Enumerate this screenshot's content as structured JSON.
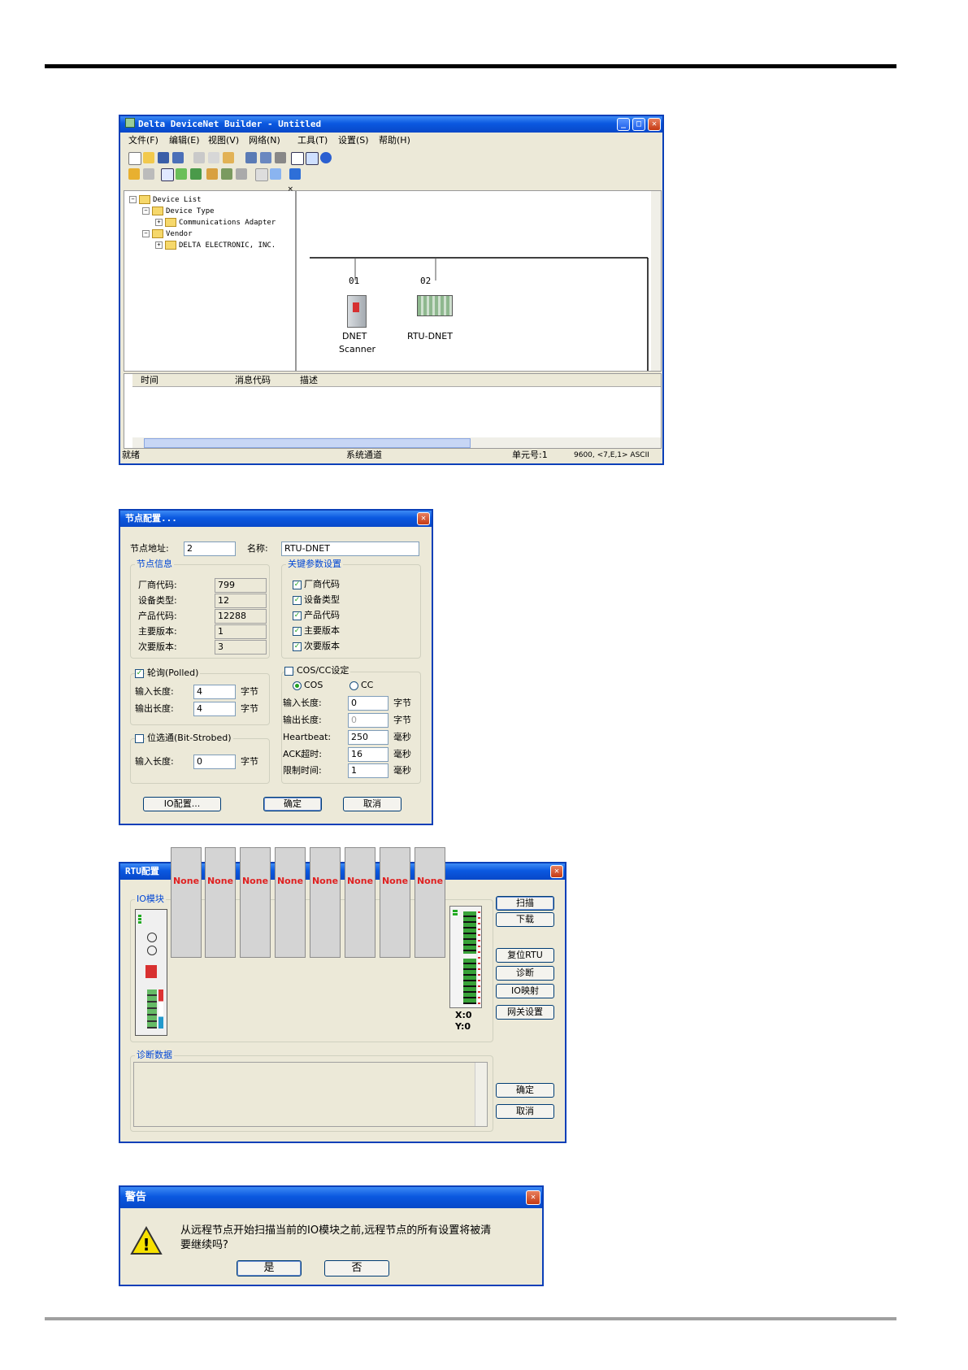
{
  "win1": {
    "title": "Delta DeviceNet Builder - Untitled",
    "menu": [
      "文件(F)",
      "编辑(E)",
      "视图(V)",
      "网络(N)",
      "工具(T)",
      "设置(S)",
      "帮助(H)"
    ],
    "tree": {
      "root": "Device List",
      "device_type": "Device Type",
      "comm_adapter": "Communications Adapter",
      "vendor": "Vendor",
      "delta": "DELTA ELECTRONIC, INC."
    },
    "nodes": [
      {
        "addr": "01",
        "label1": "DNET",
        "label2": "Scanner"
      },
      {
        "addr": "02",
        "label1": "RTU-DNET",
        "label2": ""
      }
    ],
    "log_columns": [
      "时间",
      "消息代码",
      "描述"
    ],
    "status": {
      "ready": "就绪",
      "channel": "系统通道",
      "unit": "单元号:1",
      "comm": "9600, <7,E,1> ASCII"
    }
  },
  "win2": {
    "title": "节点配置...",
    "addr_label": "节点地址:",
    "addr_value": "2",
    "name_label": "名称:",
    "name_value": "RTU-DNET",
    "info_group": "节点信息",
    "info": [
      {
        "label": "厂商代码:",
        "value": "799"
      },
      {
        "label": "设备类型:",
        "value": "12"
      },
      {
        "label": "产品代码:",
        "value": "12288"
      },
      {
        "label": "主要版本:",
        "value": "1"
      },
      {
        "label": "次要版本:",
        "value": "3"
      }
    ],
    "key_group": "关键参数设置",
    "keys": [
      "厂商代码",
      "设备类型",
      "产品代码",
      "主要版本",
      "次要版本"
    ],
    "polled_label": "轮询(Polled)",
    "polled_in_label": "输入长度:",
    "polled_in": "4",
    "polled_out_label": "输出长度:",
    "polled_out": "4",
    "unit_byte": "字节",
    "bitstrobe_label": "位选通(Bit-Strobed)",
    "bitstrobe_in_label": "输入长度:",
    "bitstrobe_in": "0",
    "cos_label": "COS/CC设定",
    "cos_opt": "COS",
    "cc_opt": "CC",
    "cos_in_label": "输入长度:",
    "cos_in": "0",
    "cos_out_label": "输出长度:",
    "cos_out": "0",
    "heartbeat_label": "Heartbeat:",
    "heartbeat": "250",
    "ack_label": "ACK超时:",
    "ack": "16",
    "limit_label": "限制时间:",
    "limit": "1",
    "unit_ms": "毫秒",
    "io_btn": "IO配置...",
    "ok_btn": "确定",
    "cancel_btn": "取消"
  },
  "win3": {
    "title": "RTU配置",
    "io_group": "IO模块",
    "slot_text": "None",
    "coord_x": "X:0",
    "coord_y": "Y:0",
    "diag_group": "诊断数据",
    "buttons": [
      "扫描",
      "下载",
      "复位RTU",
      "诊断",
      "IO映射",
      "网关设置",
      "确定",
      "取消"
    ]
  },
  "win4": {
    "title": "警告",
    "message1": "从远程节点开始扫描当前的IO模块之前,远程节点的所有设置将被清",
    "message2": "要继续吗?",
    "yes": "是",
    "no": "否"
  }
}
